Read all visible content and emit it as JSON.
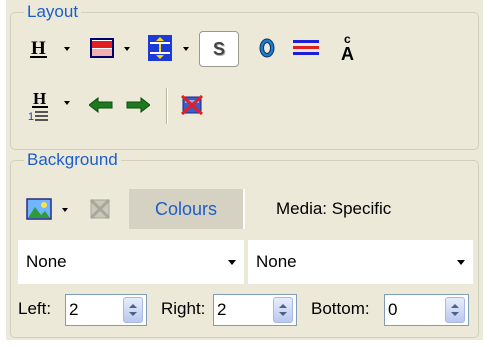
{
  "layout_group": {
    "title": "Layout",
    "icons": [
      "heading-icon",
      "border-color-icon",
      "vertical-spacing-icon",
      "shadow-s-icon",
      "outline-icon",
      "text-lines-icon",
      "letter-spacing-icon",
      "heading-numbered-icon",
      "arrow-left-icon",
      "arrow-right-icon",
      "clear-layout-icon"
    ],
    "shadow_button_label": "S"
  },
  "background_group": {
    "title": "Background",
    "icons": [
      "background-image-icon",
      "remove-image-icon"
    ],
    "tab_colours": "Colours",
    "media_label": "Media: Specific",
    "select_left": "None",
    "select_right": "None",
    "left_label": "Left:",
    "left_value": "2",
    "right_label": "Right:",
    "right_value": "2",
    "bottom_label": "Bottom:",
    "bottom_value": "0"
  }
}
